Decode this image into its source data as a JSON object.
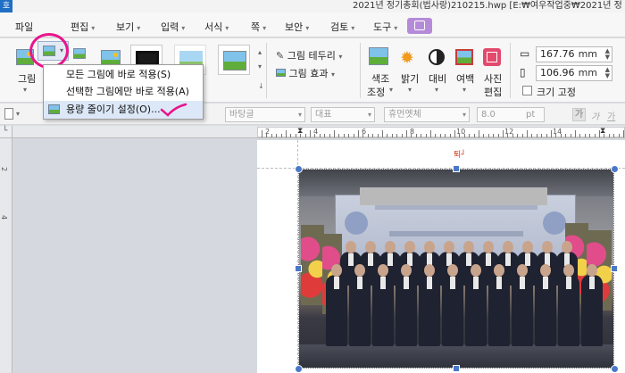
{
  "titlebar": {
    "app_logo": "호",
    "title": "2021년 정기총회(법사랑)210215.hwp [E:₩여우작업중₩2021년 정"
  },
  "menubar": {
    "items": [
      {
        "label": "파일",
        "arrow": ""
      },
      {
        "label": "편집",
        "arrow": "▾"
      },
      {
        "label": "보기",
        "arrow": "▾"
      },
      {
        "label": "입력",
        "arrow": "▾"
      },
      {
        "label": "서식",
        "arrow": "▾"
      },
      {
        "label": "쪽",
        "arrow": "▾"
      },
      {
        "label": "보안",
        "arrow": "▾"
      },
      {
        "label": "검토",
        "arrow": "▾"
      },
      {
        "label": "도구",
        "arrow": "▾"
      }
    ]
  },
  "ribbon": {
    "picture_label": "그림",
    "border_label": "그림 테두리",
    "effect_label": "그림 효과",
    "color_adjust_label": "색조",
    "color_adjust_label2": "조정",
    "brightness_label": "밝기",
    "contrast_label": "대비",
    "margin_label": "여백",
    "photo_edit_label": "사진",
    "photo_edit_label2": "편집",
    "width_value": "167.76",
    "height_value": "106.96",
    "unit": "mm",
    "size_fixed_label": "크기 고정"
  },
  "dropdown": {
    "items": [
      {
        "label": "모든 그림에 바로 적용(S)"
      },
      {
        "label": "선택한 그림에만 바로 적용(A)"
      },
      {
        "label": "용량 줄이기 설정(O)..."
      }
    ]
  },
  "formatbar": {
    "style": "바탕글",
    "lang": "대표",
    "font": "휴먼옛체",
    "size": "8.0",
    "size_unit": "pt",
    "bold": "가",
    "italic": "가",
    "underline": "가"
  },
  "ruler": {
    "h_numbers": [
      "2",
      "4",
      "6",
      "8",
      "10",
      "12",
      "14"
    ],
    "v_numbers": [
      "2",
      "4"
    ]
  },
  "document": {
    "anchor": "퇴┘"
  },
  "colors": {
    "highlight_circle": "#e8158c",
    "handle": "#4a78c9",
    "active_tab": "#b58bd9"
  }
}
